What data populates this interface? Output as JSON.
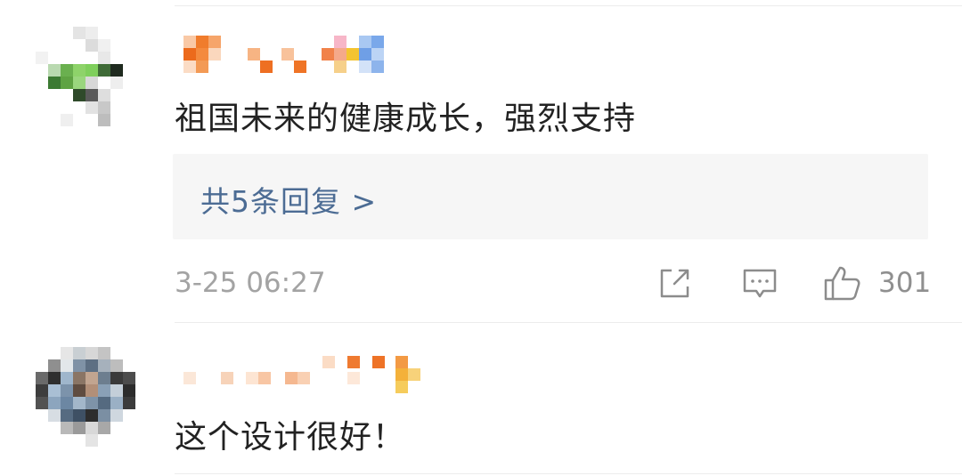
{
  "comments": [
    {
      "text": "祖国未来的健康成长，强烈支持",
      "replies_label": "共5条回复 >",
      "time": "3-25 06:27",
      "likes": "301",
      "icons": {
        "share": "share-icon",
        "comment": "comment-icon",
        "like": "thumbs-up-icon"
      }
    },
    {
      "text": "这个设计很好！"
    }
  ],
  "colors": {
    "text": "#222222",
    "link": "#4c6c94",
    "meta": "#a3a3a3",
    "reply_bg": "#f6f6f6",
    "divider": "#ececec"
  }
}
